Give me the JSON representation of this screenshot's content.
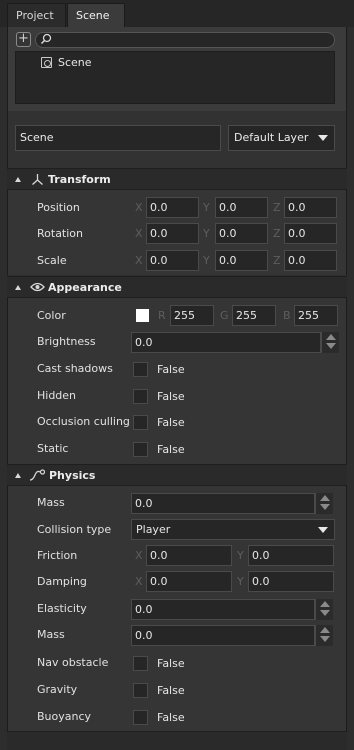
{
  "tabs": [
    {
      "label": "Project",
      "active": false
    },
    {
      "label": "Scene",
      "active": true
    }
  ],
  "toolbar": {
    "add_label": "+"
  },
  "search": {
    "placeholder": ""
  },
  "tree": {
    "items": [
      {
        "label": "Scene",
        "icon": "scene-icon"
      }
    ]
  },
  "object": {
    "name": "Scene",
    "layer": "Default Layer"
  },
  "transform": {
    "title": "Transform",
    "icon": "axes-icon",
    "rows": [
      {
        "label": "Position",
        "x": "0.0",
        "y": "0.0",
        "z": "0.0"
      },
      {
        "label": "Rotation",
        "x": "0.0",
        "y": "0.0",
        "z": "0.0"
      },
      {
        "label": "Scale",
        "x": "0.0",
        "y": "0.0",
        "z": "0.0"
      }
    ],
    "axis_labels": {
      "x": "X",
      "y": "Y",
      "z": "Z"
    }
  },
  "appearance": {
    "title": "Appearance",
    "icon": "eye-icon",
    "color": {
      "label": "Color",
      "swatch": "#ffffff",
      "r_label": "R",
      "g_label": "G",
      "b_label": "B",
      "r": "255",
      "g": "255",
      "b": "255"
    },
    "brightness": {
      "label": "Brightness",
      "value": "0.0"
    },
    "checks": [
      {
        "label": "Cast shadows",
        "value": "False"
      },
      {
        "label": "Hidden",
        "value": "False"
      },
      {
        "label": "Occlusion culling",
        "value": "False"
      },
      {
        "label": "Static",
        "value": "False"
      }
    ]
  },
  "physics": {
    "title": "Physics",
    "icon": "physics-curve-icon",
    "mass": {
      "label": "Mass",
      "value": "0.0"
    },
    "collision": {
      "label": "Collision type",
      "value": "Player"
    },
    "friction": {
      "label": "Friction",
      "x_label": "X",
      "y_label": "Y",
      "x": "0.0",
      "y": "0.0"
    },
    "damping": {
      "label": "Damping",
      "x_label": "X",
      "y_label": "Y",
      "x": "0.0",
      "y": "0.0"
    },
    "elasticity": {
      "label": "Elasticity",
      "value": "0.0"
    },
    "mass2": {
      "label": "Mass",
      "value": "0.0"
    },
    "checks": [
      {
        "label": "Nav obstacle",
        "value": "False"
      },
      {
        "label": "Gravity",
        "value": "False"
      },
      {
        "label": "Buoyancy",
        "value": "False"
      }
    ]
  }
}
